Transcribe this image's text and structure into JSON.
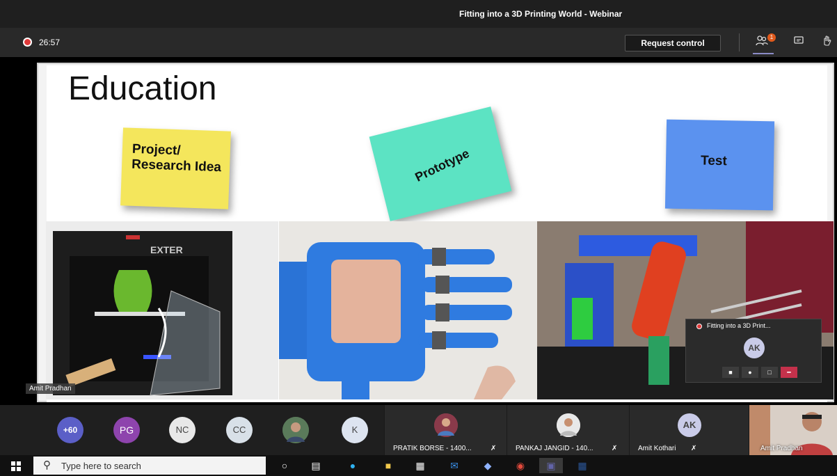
{
  "window": {
    "title": "Fitting into a 3D Printing World - Webinar"
  },
  "meeting": {
    "timer": "26:57",
    "request_control_label": "Request control",
    "participants_badge": "1"
  },
  "slide": {
    "title": "Education",
    "notes": [
      {
        "text": "Project/ Research Idea",
        "color": "#f4e65c"
      },
      {
        "text": "Prototype",
        "color": "#5ce3c3"
      },
      {
        "text": "Test",
        "color": "#5b92ef"
      }
    ],
    "photos": [
      "3D printer with green vase",
      "3D printed prosthetic hand",
      "Lab robotic setup"
    ],
    "brand": "EXTER"
  },
  "video_card": {
    "title": "Fitting into a 3D Print...",
    "avatar_initials": "AK"
  },
  "presenter_tag": "Amit Pradhan",
  "participants": {
    "overflow": "+60",
    "avatars": [
      {
        "initials": "PG",
        "color": "#8e44ad"
      },
      {
        "initials": "NC",
        "color": "#e8e8e8"
      },
      {
        "initials": "CC",
        "color": "#d8e0e8"
      },
      {
        "initials": "",
        "color": "#4a6a4a"
      },
      {
        "initials": "K",
        "color": "#dde4f0"
      }
    ],
    "tiles": [
      {
        "name": "PRATIK BORSE - 1400..."
      },
      {
        "name": "PANKAJ JANGID - 140..."
      },
      {
        "name": "Amit Kothari",
        "initials": "AK"
      },
      {
        "name": "Amit Pradhan"
      }
    ]
  },
  "taskbar": {
    "search_placeholder": "Type here to search"
  }
}
